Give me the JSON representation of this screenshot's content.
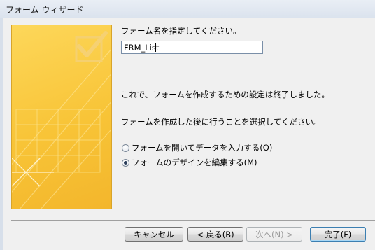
{
  "window": {
    "title": "フォーム ウィザード"
  },
  "form_name": {
    "prompt": "フォーム名を指定してください。",
    "value": "FRM_List"
  },
  "info": {
    "line1": "これで、フォームを作成するための設定は終了しました。",
    "line2": "フォームを作成した後に行うことを選択してください。"
  },
  "options": [
    {
      "label": "フォームを開いてデータを入力する(O)",
      "checked": false
    },
    {
      "label": "フォームのデザインを編集する(M)",
      "checked": true
    }
  ],
  "buttons": {
    "cancel": "キャンセル",
    "back": "< 戻る(B)",
    "next": "次へ(N) >",
    "finish": "完了(F)"
  },
  "icons": {
    "wizard_art": "checkmark-form-illustration-icon"
  },
  "colors": {
    "art_yellow": "#f8c437",
    "default_button_border": "#3c7fb1"
  }
}
